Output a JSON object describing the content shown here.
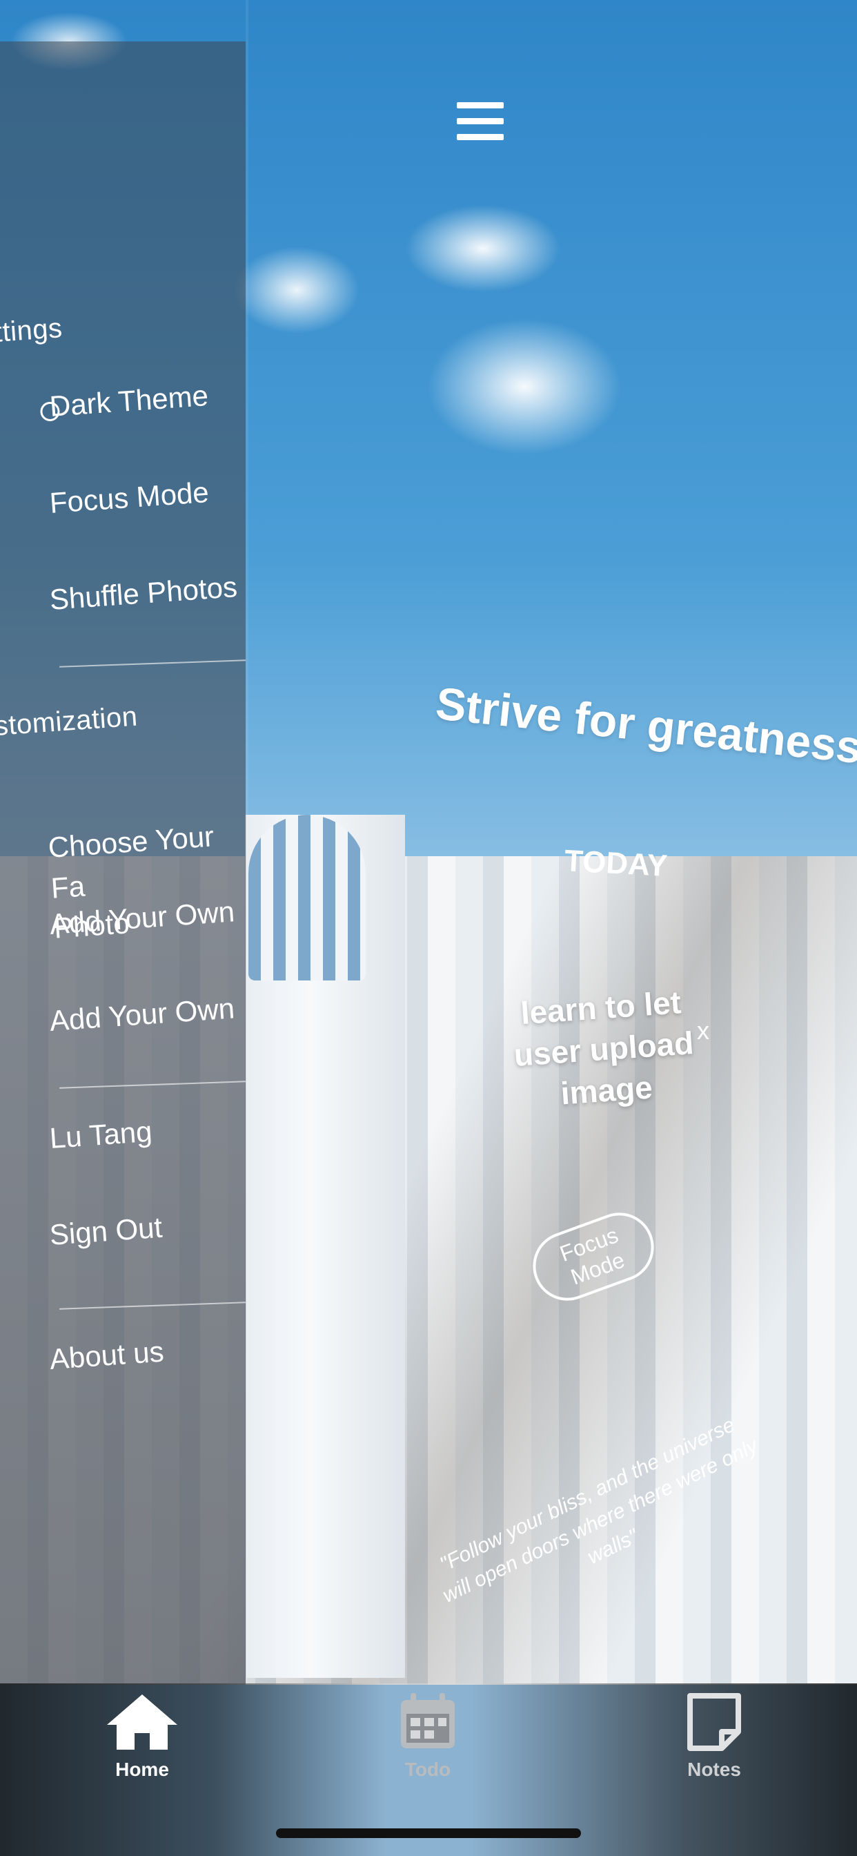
{
  "drawer": {
    "settings_header": "ttings",
    "settings_items": [
      {
        "label": "Dark Theme"
      },
      {
        "label": "Focus Mode"
      },
      {
        "label": "Shuffle Photos"
      }
    ],
    "customization_header": "stomization",
    "customization_items": [
      {
        "label": "Choose Your Fa\nPhoto"
      },
      {
        "label": "Add Your Own"
      },
      {
        "label": "Add Your Own"
      }
    ],
    "account_items": [
      {
        "label": "Lu Tang"
      },
      {
        "label": "Sign Out"
      }
    ],
    "about_label": "About us"
  },
  "main": {
    "quote": "Strive for greatness.",
    "today_label": "TODAY",
    "task_text": "learn to let user upload image",
    "task_close": "x",
    "focus_button": "Focus Mode",
    "footer_quote": "\"Follow your bliss, and the universe will open doors where there were only walls\""
  },
  "tabbar": {
    "tabs": [
      {
        "label": "Home",
        "icon": "home-icon",
        "active": true
      },
      {
        "label": "Todo",
        "icon": "calendar-icon",
        "active": false
      },
      {
        "label": "Notes",
        "icon": "note-icon",
        "active": false
      }
    ]
  }
}
